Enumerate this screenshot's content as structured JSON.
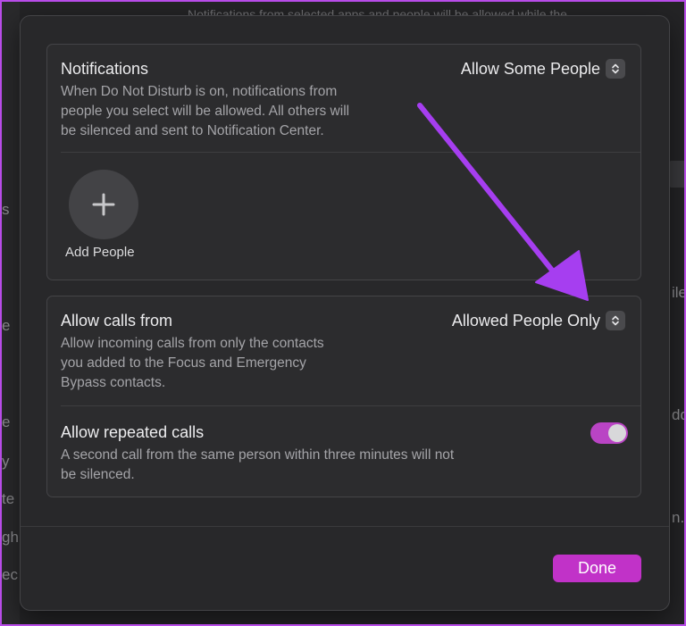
{
  "background": {
    "top_text": "Notifications from selected apps and people will be allowed while the",
    "side_fragments": [
      "s",
      "e",
      "e",
      "y",
      "te",
      "gh",
      "ec"
    ],
    "right_fragments": [
      "ile",
      "dd",
      "n."
    ]
  },
  "notifications": {
    "title": "Notifications",
    "mode": "Allow Some People",
    "description_lines": [
      "When Do Not Disturb is on, notifications from",
      "people you select will be allowed. All others will",
      "be silenced and sent to Notification Center."
    ],
    "add_people_label": "Add People"
  },
  "calls": {
    "title": "Allow calls from",
    "mode": "Allowed People Only",
    "description_lines": [
      "Allow incoming calls from only the contacts",
      "you added to the Focus and Emergency",
      "Bypass contacts."
    ],
    "repeated": {
      "title": "Allow repeated calls",
      "enabled": true,
      "description_lines": [
        "A second call from the same person within three minutes will not",
        "be silenced."
      ]
    }
  },
  "footer": {
    "done_label": "Done"
  },
  "colors": {
    "accent": "#c132c8",
    "toggle_on": "#b944c4",
    "annotation_arrow": "#a63ef0",
    "frame": "#b84ce8"
  }
}
